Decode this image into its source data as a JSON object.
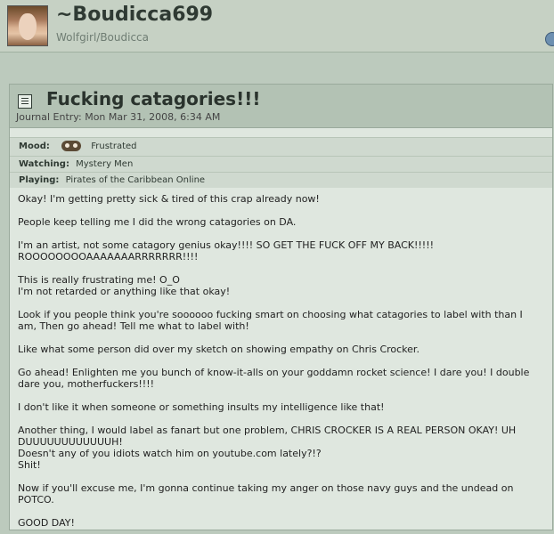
{
  "header": {
    "username": "~Boudicca699",
    "subtitle": "Wolfgirl/Boudicca"
  },
  "journal": {
    "title": "Fucking catagories!!!",
    "date": "Journal Entry: Mon Mar 31, 2008, 6:34 AM",
    "meta": {
      "mood_label": "Mood:",
      "mood_value": "Frustrated",
      "watching_label": "Watching:",
      "watching_value": "Mystery Men",
      "playing_label": "Playing:",
      "playing_value": "Pirates of the Caribbean Online"
    },
    "paragraphs": [
      "Okay! I'm getting pretty sick & tired of this crap already now!",
      "People keep telling me I did the wrong catagories on DA.",
      "I'm an artist, not some catagory genius okay!!!! SO GET THE FUCK OFF MY BACK!!!!!\nROOOOOOOOAAAAAAARRRRRRR!!!!",
      "This is really frustrating me! O_O\nI'm not retarded or anything like that okay!",
      "Look if you people think you're soooooo fucking smart on choosing what catagories to label with than I am, Then go ahead! Tell me what to label with!",
      "Like what some person did over my sketch on showing empathy on Chris Crocker.",
      "Go ahead! Enlighten me you bunch of know-it-alls on your goddamn rocket science! I dare you! I double dare you, motherfuckers!!!!",
      "I don't like it when someone or something insults my intelligence like that!",
      "Another thing, I would label as fanart but one problem, CHRIS CROCKER IS A REAL PERSON OKAY! UH DUUUUUUUUUUUUH!\nDoesn't any of you idiots watch him on youtube.com lately?!?\nShit!",
      "Now if you'll excuse me, I'm gonna continue taking my anger on those navy guys and the undead on POTCO.",
      "GOOD DAY!"
    ]
  }
}
